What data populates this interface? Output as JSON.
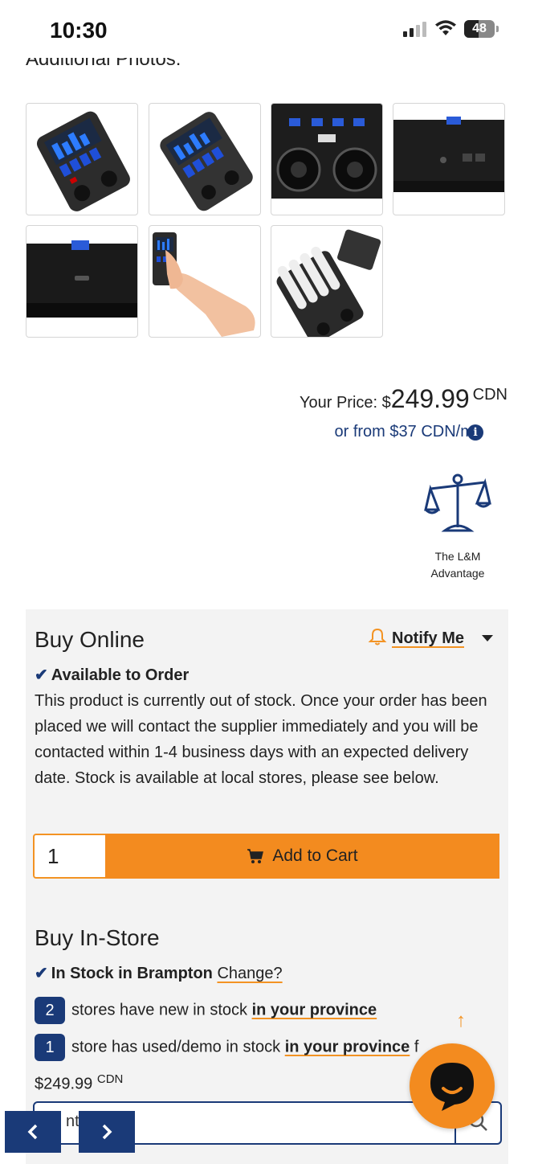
{
  "status": {
    "time": "10:30",
    "battery": "48",
    "battery_level": 0.48
  },
  "gallery": {
    "title": "Additional Photos:"
  },
  "pricing": {
    "label": "Your Price: $",
    "amount": "249.99",
    "currency": "CDN",
    "finance": "or from $37 CDN/mo"
  },
  "advantage": {
    "line1": "The L&M",
    "line2": "Advantage"
  },
  "buy_online": {
    "title": "Buy Online",
    "notify": "Notify Me",
    "availability": "Available to Order",
    "description": "This product is currently out of stock. Once your order has been placed we will contact the supplier immediately and you will be contacted within 1-4 business days with an expected delivery date. Stock is available at local stores, please see below.",
    "quantity": "1",
    "add_to_cart": "Add to Cart"
  },
  "buy_instore": {
    "title": "Buy In-Store",
    "stock_prefix": "In Stock in Brampton",
    "change": "Change?",
    "new_count": "2",
    "new_text": "stores have new in stock",
    "new_link": "in your province",
    "used_count": "1",
    "used_text": "store has used/demo in stock",
    "used_link": "in your province",
    "used_tail": "f",
    "price": "$249.99",
    "price_currency": "CDN",
    "search_partial": "nta"
  },
  "colors": {
    "accent": "#f38b1f",
    "navy": "#1a3a78",
    "panel": "#f3f3f3"
  },
  "icons": [
    "info-icon",
    "scales-icon",
    "bell-icon",
    "check-icon",
    "cart-icon",
    "arrow-up-icon",
    "search-icon",
    "chevron-left-icon",
    "chevron-right-icon",
    "chat-icon"
  ]
}
